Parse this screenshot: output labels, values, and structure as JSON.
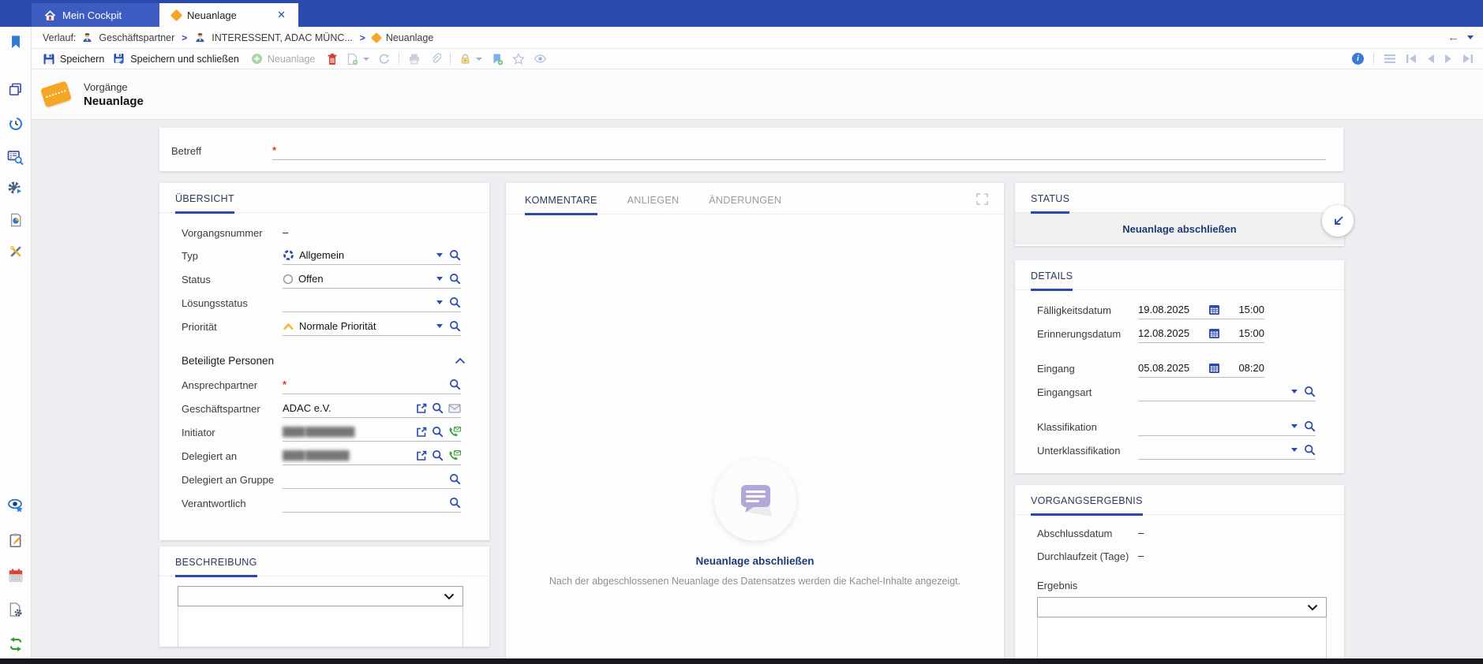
{
  "colors": {
    "accent": "#2b4aad",
    "orange": "#f5a623",
    "required": "#e0372e",
    "topbar": "#2b4aad"
  },
  "icons": {
    "home-icon": "house",
    "ticket-icon": "orange ticket",
    "contact-icon": "person",
    "search-icon": "magnifier",
    "calendar-icon": "calendar",
    "mail-icon": "envelope",
    "phone-contact-icon": "green phone",
    "open-record-icon": "square with arrow",
    "save-icon": "floppy",
    "trash-icon": "red trash",
    "lock-icon": "padlock",
    "expand-icon": "fullscreen corners",
    "collapse-arrow-icon": "arrow down-left"
  },
  "topbar": {
    "tabs": [
      {
        "label": "Mein Cockpit"
      },
      {
        "label": "Neuanlage"
      }
    ]
  },
  "breadcrumb": {
    "prefix": "Verlauf:",
    "sep": ">",
    "items": [
      {
        "label": "Geschäftspartner"
      },
      {
        "label": "INTERESSENT, ADAC MÜNC..."
      },
      {
        "label": "Neuanlage"
      }
    ]
  },
  "toolbar": {
    "save": "Speichern",
    "save_close": "Speichern und schließen",
    "new_record": "Neuanlage"
  },
  "header": {
    "category": "Vorgänge",
    "title": "Neuanlage"
  },
  "betreff": {
    "label": "Betreff",
    "required": "*"
  },
  "overview": {
    "tab": "ÜBERSICHT",
    "rows": [
      {
        "label": "Vorgangsnummer",
        "value": "–"
      },
      {
        "label": "Typ",
        "value": "Allgemein"
      },
      {
        "label": "Status",
        "value": "Offen"
      },
      {
        "label": "Lösungsstatus",
        "value": ""
      },
      {
        "label": "Priorität",
        "value": "Normale Priorität"
      }
    ],
    "persons": {
      "title": "Beteiligte Personen",
      "rows": [
        {
          "label": "Ansprechpartner",
          "value": "",
          "required": "*"
        },
        {
          "label": "Geschäftspartner",
          "value": "ADAC e.V."
        },
        {
          "label": "Initiator",
          "value": "████ █████████"
        },
        {
          "label": "Delegiert an",
          "value": "████ ████████"
        },
        {
          "label": "Delegiert an Gruppe",
          "value": ""
        },
        {
          "label": "Verantwortlich",
          "value": ""
        }
      ]
    }
  },
  "description": {
    "tab": "BESCHREIBUNG"
  },
  "comments": {
    "tabs": [
      {
        "label": "KOMMENTARE"
      },
      {
        "label": "ANLIEGEN"
      },
      {
        "label": "ÄNDERUNGEN"
      }
    ],
    "empty": {
      "title": "Neuanlage abschließen",
      "subtitle": "Nach der abgeschlossenen Neuanlage des Datensatzes werden die Kachel-Inhalte angezeigt."
    }
  },
  "status_panel": {
    "tab": "STATUS",
    "action": "Neuanlage abschließen"
  },
  "details": {
    "tab": "DETAILS",
    "rows": [
      {
        "label": "Fälligkeitsdatum",
        "date": "19.08.2025",
        "time": "15:00"
      },
      {
        "label": "Erinnerungsdatum",
        "date": "12.08.2025",
        "time": "15:00"
      },
      {
        "label": "Eingang",
        "date": "05.08.2025",
        "time": "08:20"
      },
      {
        "label": "Eingangsart",
        "value": ""
      },
      {
        "label": "Klassifikation",
        "value": ""
      },
      {
        "label": "Unterklassifikation",
        "value": ""
      }
    ]
  },
  "result": {
    "tab": "VORGANGSERGEBNIS",
    "rows": [
      {
        "label": "Abschlussdatum",
        "value": "–"
      },
      {
        "label": "Durchlaufzeit (Tage)",
        "value": "–"
      }
    ],
    "ergebnis_label": "Ergebnis"
  }
}
